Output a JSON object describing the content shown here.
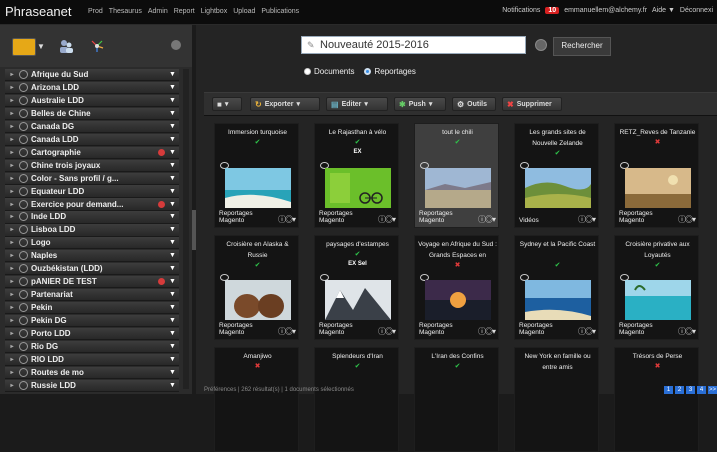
{
  "brand": "Phraseanet",
  "nav": [
    "Prod",
    "Thesaurus",
    "Admin",
    "Report",
    "Lightbox",
    "Upload",
    "Publications"
  ],
  "right_nav": {
    "notifications_label": "Notifications",
    "notifications_count": "10",
    "user_email": "emmanuellem@alchemy.fr",
    "help_label": "Aide ▼",
    "logout_label": "Déconnexi"
  },
  "search": {
    "value": "Nouveauté 2015-2016",
    "button_label": "Rechercher",
    "radio_documents": "Documents",
    "radio_reportages": "Reportages",
    "selected": "Reportages"
  },
  "toolbar": {
    "export": "Exporter",
    "edit": "Editer",
    "push": "Push",
    "tools": "Outils",
    "delete": "Supprimer"
  },
  "baskets": [
    {
      "label": "Afrique du Sud",
      "dot": false
    },
    {
      "label": "Arizona LDD",
      "dot": false
    },
    {
      "label": "Australie LDD",
      "dot": false
    },
    {
      "label": "Belles de Chine",
      "dot": false
    },
    {
      "label": "Canada DG",
      "dot": false
    },
    {
      "label": "Canada LDD",
      "dot": false
    },
    {
      "label": "Cartographie",
      "dot": true
    },
    {
      "label": "Chine trois joyaux",
      "dot": false
    },
    {
      "label": "Color - Sans profil / g...",
      "dot": false
    },
    {
      "label": "Equateur LDD",
      "dot": false
    },
    {
      "label": "Exercice pour demand...",
      "dot": true
    },
    {
      "label": "Inde LDD",
      "dot": false
    },
    {
      "label": "Lisboa LDD",
      "dot": false
    },
    {
      "label": "Logo",
      "dot": false
    },
    {
      "label": "Naples",
      "dot": false
    },
    {
      "label": "Ouzbékistan (LDD)",
      "dot": false
    },
    {
      "label": "pANIER DE TEST",
      "dot": true
    },
    {
      "label": "Partenariat",
      "dot": false
    },
    {
      "label": "Pekin",
      "dot": false
    },
    {
      "label": "Pekin DG",
      "dot": false
    },
    {
      "label": "Porto LDD",
      "dot": false
    },
    {
      "label": "Rio DG",
      "dot": false
    },
    {
      "label": "RIO LDD",
      "dot": false
    },
    {
      "label": "Routes de mo",
      "dot": false
    },
    {
      "label": "Russie LDD",
      "dot": false
    }
  ],
  "cards": [
    {
      "title": "Immersion turquoise",
      "status": "ok",
      "badge": "",
      "collection": "Reportages",
      "base": "Magento",
      "scene": "beach",
      "selected": false
    },
    {
      "title": "Le Rajasthan à vélo",
      "status": "ok",
      "badge": "EX",
      "collection": "Reportages",
      "base": "Magento",
      "scene": "green",
      "selected": false
    },
    {
      "title": "tout le chili",
      "status": "ok",
      "badge": "",
      "collection": "Reportages",
      "base": "Magento",
      "scene": "desert",
      "selected": true
    },
    {
      "title": "Les grands sites de Nouvelle Zelande",
      "status": "ok",
      "badge": "",
      "collection": "",
      "base": "Vidéos",
      "scene": "hills",
      "selected": false
    },
    {
      "title": "RETZ_Reves de Tanzanie",
      "status": "no",
      "badge": "",
      "collection": "Reportages",
      "base": "Magento",
      "scene": "savanna",
      "selected": false
    },
    {
      "title": "Croisière en Alaska & Russie",
      "status": "ok",
      "badge": "",
      "collection": "Reportages",
      "base": "Magento",
      "scene": "bears",
      "selected": false
    },
    {
      "title": "paysages d'estampes",
      "status": "ok",
      "badge": "EX Sel",
      "collection": "Reportages",
      "base": "Magento",
      "scene": "mountains",
      "selected": false
    },
    {
      "title": "Voyage en Afrique du Sud : Grands Espaces en",
      "status": "no",
      "badge": "",
      "collection": "Reportages",
      "base": "Magento",
      "scene": "sunset",
      "selected": false
    },
    {
      "title": "Sydney et la Pacific Coast",
      "status": "ok",
      "badge": "",
      "collection": "Reportages",
      "base": "Magento",
      "scene": "coast",
      "selected": false
    },
    {
      "title": "Croisière privative aux Loyautés",
      "status": "ok",
      "badge": "",
      "collection": "Reportages",
      "base": "Magento",
      "scene": "lagoon",
      "selected": false
    },
    {
      "title": "Amanjiwo",
      "status": "no",
      "badge": "",
      "collection": "",
      "base": "",
      "scene": "",
      "selected": false
    },
    {
      "title": "Splendeurs d'Iran",
      "status": "ok",
      "badge": "",
      "collection": "",
      "base": "",
      "scene": "",
      "selected": false
    },
    {
      "title": "L'Iran des Confins",
      "status": "ok",
      "badge": "",
      "collection": "",
      "base": "",
      "scene": "",
      "selected": false
    },
    {
      "title": "New York en famille ou entre amis",
      "status": "",
      "badge": "",
      "collection": "",
      "base": "",
      "scene": "",
      "selected": false
    },
    {
      "title": "Trésors de Perse",
      "status": "no",
      "badge": "",
      "collection": "",
      "base": "",
      "scene": "",
      "selected": false
    }
  ],
  "status_bar": "Préférences | 262 résultat(s) | 1 documents sélectionnés",
  "pager": [
    "1",
    "2",
    "3",
    "4",
    ">>"
  ],
  "colors": {
    "accent": "#3a8ee6",
    "badge": "#d62020",
    "ok": "#2ec44a",
    "no": "#e03a3a"
  }
}
